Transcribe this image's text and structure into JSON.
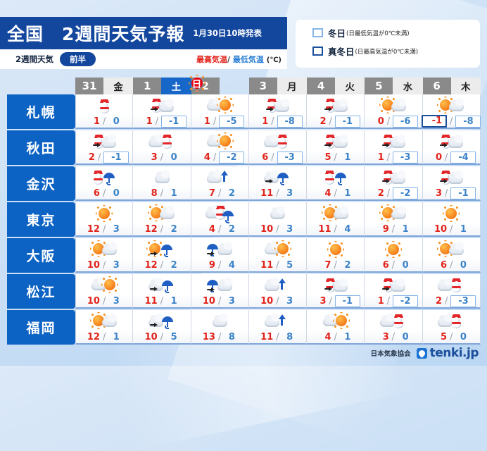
{
  "header": {
    "title": "全国　2週間天気予報",
    "issued": "1月30日10時発表",
    "sub_label": "2週間天気",
    "sub_pill": "前半",
    "high_label": "最高気温",
    "slash": "/",
    "low_label": "最低気温",
    "unit": "(℃)"
  },
  "legend": {
    "items": [
      {
        "term": "冬日",
        "note": "(日最低気温が0℃未満)",
        "box": "light",
        "color": "#86b4e8"
      },
      {
        "term": "真冬日",
        "note": "(日最高気温が0℃未満)",
        "box": "dark",
        "color": "#1b4f9c"
      }
    ]
  },
  "days": [
    {
      "num": "31",
      "dow": "金",
      "kind": "weekday"
    },
    {
      "num": "1",
      "dow": "土",
      "kind": "sat"
    },
    {
      "num": "2",
      "dow": "日",
      "kind": "sun"
    },
    {
      "num": "3",
      "dow": "月",
      "kind": "weekday"
    },
    {
      "num": "4",
      "dow": "火",
      "kind": "weekday"
    },
    {
      "num": "5",
      "dow": "水",
      "kind": "weekday"
    },
    {
      "num": "6",
      "dow": "木",
      "kind": "weekday"
    }
  ],
  "rows": [
    {
      "city": "札幌",
      "cells": [
        {
          "icon": "snow",
          "hi": "1",
          "lo": "0",
          "hi_mark": "none",
          "lo_mark": "none"
        },
        {
          "icon": "snow-cloud",
          "hi": "1",
          "lo": "-1",
          "hi_mark": "none",
          "lo_mark": "light"
        },
        {
          "icon": "cloud-sun",
          "hi": "1",
          "lo": "-5",
          "hi_mark": "none",
          "lo_mark": "light"
        },
        {
          "icon": "snow-cloud",
          "hi": "1",
          "lo": "-8",
          "hi_mark": "none",
          "lo_mark": "light"
        },
        {
          "icon": "snow-cloud",
          "hi": "2",
          "lo": "-1",
          "hi_mark": "none",
          "lo_mark": "light"
        },
        {
          "icon": "sun-cloud",
          "hi": "0",
          "lo": "-6",
          "hi_mark": "none",
          "lo_mark": "light"
        },
        {
          "icon": "sun-cloud",
          "hi": "-1",
          "lo": "-8",
          "hi_mark": "dark",
          "lo_mark": "light"
        }
      ]
    },
    {
      "city": "秋田",
      "cells": [
        {
          "icon": "snow-cloud",
          "hi": "2",
          "lo": "-1",
          "hi_mark": "none",
          "lo_mark": "light"
        },
        {
          "icon": "cloud-snow",
          "hi": "3",
          "lo": "0",
          "hi_mark": "none",
          "lo_mark": "none"
        },
        {
          "icon": "cloud-sun",
          "hi": "4",
          "lo": "-2",
          "hi_mark": "none",
          "lo_mark": "light"
        },
        {
          "icon": "cloud-snow",
          "hi": "6",
          "lo": "-3",
          "hi_mark": "none",
          "lo_mark": "light"
        },
        {
          "icon": "snow-cloud",
          "hi": "5",
          "lo": "1",
          "hi_mark": "none",
          "lo_mark": "none"
        },
        {
          "icon": "snow-cloud",
          "hi": "1",
          "lo": "-3",
          "hi_mark": "none",
          "lo_mark": "light"
        },
        {
          "icon": "snow-cloud",
          "hi": "0",
          "lo": "-4",
          "hi_mark": "none",
          "lo_mark": "light"
        }
      ]
    },
    {
      "city": "金沢",
      "cells": [
        {
          "icon": "snow-rain",
          "hi": "6",
          "lo": "0",
          "hi_mark": "none",
          "lo_mark": "none"
        },
        {
          "icon": "cloud",
          "hi": "8",
          "lo": "1",
          "hi_mark": "none",
          "lo_mark": "none"
        },
        {
          "icon": "cloud-dart",
          "hi": "7",
          "lo": "2",
          "hi_mark": "none",
          "lo_mark": "none"
        },
        {
          "icon": "cloud-rain",
          "hi": "11",
          "lo": "3",
          "hi_mark": "none",
          "lo_mark": "none"
        },
        {
          "icon": "snow-rain",
          "hi": "4",
          "lo": "1",
          "hi_mark": "none",
          "lo_mark": "none"
        },
        {
          "icon": "snow-cloud",
          "hi": "2",
          "lo": "-2",
          "hi_mark": "none",
          "lo_mark": "light"
        },
        {
          "icon": "snow-cloud",
          "hi": "3",
          "lo": "-1",
          "hi_mark": "none",
          "lo_mark": "light"
        }
      ]
    },
    {
      "city": "東京",
      "cells": [
        {
          "icon": "sun",
          "hi": "12",
          "lo": "3",
          "hi_mark": "none",
          "lo_mark": "none"
        },
        {
          "icon": "sun-cloud",
          "hi": "12",
          "lo": "2",
          "hi_mark": "none",
          "lo_mark": "none"
        },
        {
          "icon": "cloud-snow-rain",
          "hi": "4",
          "lo": "2",
          "hi_mark": "none",
          "lo_mark": "none"
        },
        {
          "icon": "cloud",
          "hi": "10",
          "lo": "3",
          "hi_mark": "none",
          "lo_mark": "none"
        },
        {
          "icon": "sun-cloud",
          "hi": "11",
          "lo": "4",
          "hi_mark": "none",
          "lo_mark": "none"
        },
        {
          "icon": "sun-cloud",
          "hi": "9",
          "lo": "1",
          "hi_mark": "none",
          "lo_mark": "none"
        },
        {
          "icon": "sun",
          "hi": "10",
          "lo": "1",
          "hi_mark": "none",
          "lo_mark": "none"
        }
      ]
    },
    {
      "city": "大阪",
      "cells": [
        {
          "icon": "sun-cloud",
          "hi": "10",
          "lo": "3",
          "hi_mark": "none",
          "lo_mark": "none"
        },
        {
          "icon": "sun-rain",
          "hi": "12",
          "lo": "2",
          "hi_mark": "none",
          "lo_mark": "none"
        },
        {
          "icon": "rain-cloud",
          "hi": "9",
          "lo": "4",
          "hi_mark": "none",
          "lo_mark": "none"
        },
        {
          "icon": "cloud-sun",
          "hi": "11",
          "lo": "5",
          "hi_mark": "none",
          "lo_mark": "none"
        },
        {
          "icon": "sun",
          "hi": "7",
          "lo": "2",
          "hi_mark": "none",
          "lo_mark": "none"
        },
        {
          "icon": "sun",
          "hi": "6",
          "lo": "0",
          "hi_mark": "none",
          "lo_mark": "none"
        },
        {
          "icon": "sun-cloud",
          "hi": "6",
          "lo": "0",
          "hi_mark": "none",
          "lo_mark": "none"
        }
      ]
    },
    {
      "city": "松江",
      "cells": [
        {
          "icon": "cloud-sun",
          "hi": "10",
          "lo": "3",
          "hi_mark": "none",
          "lo_mark": "none"
        },
        {
          "icon": "cloud-rain",
          "hi": "11",
          "lo": "1",
          "hi_mark": "none",
          "lo_mark": "none"
        },
        {
          "icon": "rain-cloud",
          "hi": "10",
          "lo": "3",
          "hi_mark": "none",
          "lo_mark": "none"
        },
        {
          "icon": "cloud-dart",
          "hi": "10",
          "lo": "3",
          "hi_mark": "none",
          "lo_mark": "none"
        },
        {
          "icon": "snow-cloud",
          "hi": "3",
          "lo": "-1",
          "hi_mark": "none",
          "lo_mark": "light"
        },
        {
          "icon": "snow-cloud",
          "hi": "1",
          "lo": "-2",
          "hi_mark": "none",
          "lo_mark": "light"
        },
        {
          "icon": "cloud-snow",
          "hi": "2",
          "lo": "-3",
          "hi_mark": "none",
          "lo_mark": "light"
        }
      ]
    },
    {
      "city": "福岡",
      "cells": [
        {
          "icon": "sun-cloud",
          "hi": "12",
          "lo": "1",
          "hi_mark": "none",
          "lo_mark": "none"
        },
        {
          "icon": "cloud-rain",
          "hi": "10",
          "lo": "5",
          "hi_mark": "none",
          "lo_mark": "none"
        },
        {
          "icon": "cloud",
          "hi": "13",
          "lo": "8",
          "hi_mark": "none",
          "lo_mark": "none"
        },
        {
          "icon": "cloud-dart",
          "hi": "11",
          "lo": "8",
          "hi_mark": "none",
          "lo_mark": "none"
        },
        {
          "icon": "cloud-sun",
          "hi": "4",
          "lo": "1",
          "hi_mark": "none",
          "lo_mark": "none"
        },
        {
          "icon": "cloud-snow",
          "hi": "3",
          "lo": "0",
          "hi_mark": "none",
          "lo_mark": "none"
        },
        {
          "icon": "cloud-snow",
          "hi": "5",
          "lo": "0",
          "hi_mark": "none",
          "lo_mark": "none"
        }
      ]
    }
  ],
  "footer": {
    "association": "日本気象協会",
    "brand": "tenki.jp"
  }
}
